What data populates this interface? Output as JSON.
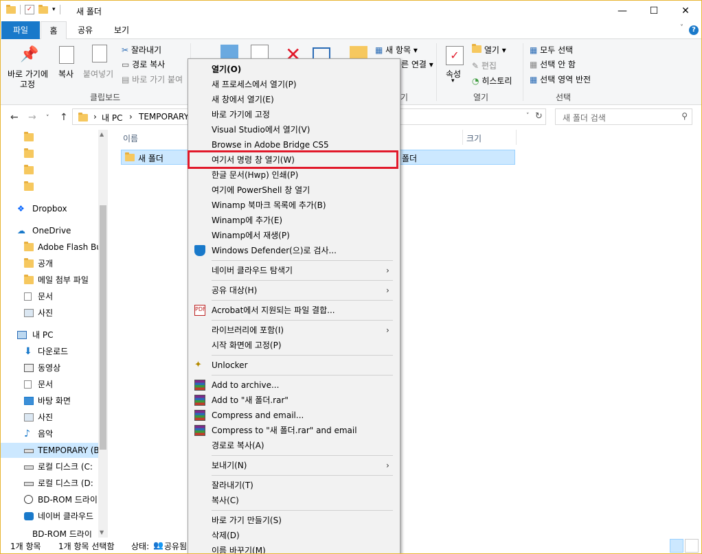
{
  "window": {
    "title": "새 폴더",
    "controls": {
      "minimize": "—",
      "maximize": "☐",
      "close": "✕"
    }
  },
  "ribbon_tabs": [
    "파일",
    "홈",
    "공유",
    "보기"
  ],
  "ribbon": {
    "pin_label_1": "바로 가기에",
    "pin_label_2": "고정",
    "copy_label": "복사",
    "paste_label": "붙여넣기",
    "cut_label": "잘라내기",
    "copy_path_label": "경로 복사",
    "paste_shortcut_label": "바로 가기 붙여",
    "clipboard_group": "클립보드",
    "new_item_label": "새 항목 ▾",
    "easy_access_label": "른 연결 ▾",
    "organize_group_tail": "기",
    "properties_label": "속성",
    "open_label": "열기 ▾",
    "edit_label": "편집",
    "history_label": "히스토리",
    "open_group": "열기",
    "select_all_label": "모두 선택",
    "select_none_label": "선택 안 함",
    "invert_selection_label": "선택 영역 반전",
    "select_group": "선택"
  },
  "address": {
    "path_root": "내 PC",
    "path_sep": "›",
    "path_drive": "TEMPORARY",
    "search_placeholder": "새 폴더 검색"
  },
  "nav_pane": {
    "items": [
      {
        "label": ""
      },
      {
        "label": ""
      },
      {
        "label": ""
      },
      {
        "label": ""
      },
      {
        "label": "Dropbox"
      },
      {
        "label": "OneDrive"
      },
      {
        "label": "Adobe Flash Bui"
      },
      {
        "label": "공개"
      },
      {
        "label": "메일 첨부 파일"
      },
      {
        "label": "문서"
      },
      {
        "label": "사진"
      },
      {
        "label": "내 PC"
      },
      {
        "label": "다운로드"
      },
      {
        "label": "동영상"
      },
      {
        "label": "문서"
      },
      {
        "label": "바탕 화면"
      },
      {
        "label": "사진"
      },
      {
        "label": "음악"
      },
      {
        "label": "TEMPORARY (B:"
      },
      {
        "label": "로컬 디스크 (C:"
      },
      {
        "label": "로컬 디스크 (D:"
      },
      {
        "label": "BD-ROM 드라이"
      },
      {
        "label": "네이버 클라우드"
      },
      {
        "label": "BD-ROM 드라이"
      }
    ]
  },
  "file_list": {
    "columns": [
      "이름",
      "크기"
    ],
    "rows": [
      {
        "name": "새 폴더",
        "type_partial": "폴더"
      }
    ]
  },
  "status": {
    "count": "1개 항목",
    "selected": "1개 항목 선택함",
    "state": "상태:",
    "state_value": "공유됨"
  },
  "context_menu": {
    "items": [
      "열기(O)",
      "새 프로세스에서 열기(P)",
      "새 창에서 열기(E)",
      "바로 가기에 고정",
      "Visual Studio에서 열기(V)",
      "Browse in Adobe Bridge CS5",
      "여기서 명령 창 열기(W)",
      "한글 문서(Hwp) 인쇄(P)",
      "여기에 PowerShell 창 열기",
      "Winamp 북마크 목록에 추가(B)",
      "Winamp에 추가(E)",
      "Winamp에서 재생(P)",
      "Windows Defender(으)로 검사...",
      "네이버 클라우드 탐색기",
      "공유 대상(H)",
      "Acrobat에서 지원되는 파일 결합...",
      "라이브러리에 포함(I)",
      "시작 화면에 고정(P)",
      "Unlocker",
      "Add to archive...",
      "Add to \"새 폴더.rar\"",
      "Compress and email...",
      "Compress to \"새 폴더.rar\" and email",
      "경로로 복사(A)",
      "보내기(N)",
      "잘라내기(T)",
      "복사(C)",
      "바로 가기 만들기(S)",
      "삭제(D)",
      "이름 바꾸기(M)"
    ],
    "submenu_arrow": "›"
  },
  "colors": {
    "accent": "#1979ca",
    "highlight_border": "#e1192a",
    "selection": "#cce8ff"
  }
}
